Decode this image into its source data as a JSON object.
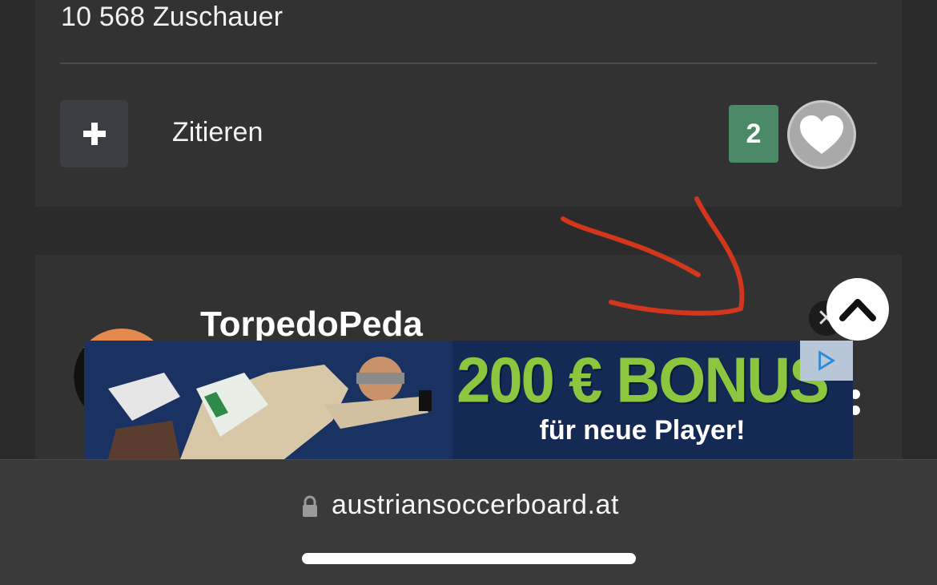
{
  "post": {
    "viewers": "10 568 Zuschauer",
    "quote_label": "Zitieren",
    "like_count": "2"
  },
  "next_post": {
    "username": "TorpedoPeda"
  },
  "ad": {
    "headline": "200 € BONUS",
    "subline": "für neue Player!",
    "headline_color": "#8cc63f",
    "background_color": "#142a55"
  },
  "browser": {
    "url": "austriansoccerboard.at"
  },
  "colors": {
    "like_badge": "#4a8a66",
    "annotation_arrow": "#d2361c"
  }
}
